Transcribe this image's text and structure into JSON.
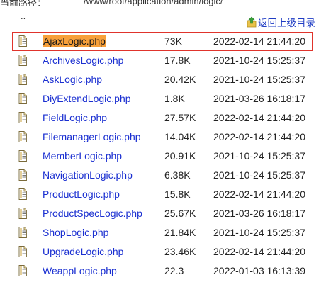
{
  "path_bar": {
    "label": "当前路径：",
    "value": "/www/root/application/admin/logic/"
  },
  "parent_link": "..",
  "back_link": {
    "label": "返回上级目录",
    "icon": "folder-up-icon"
  },
  "files": [
    {
      "name": "AjaxLogic.php",
      "size": "73K",
      "date": "2022-02-14 21:44:20",
      "highlighted": true
    },
    {
      "name": "ArchivesLogic.php",
      "size": "17.8K",
      "date": "2021-10-24 15:25:37"
    },
    {
      "name": "AskLogic.php",
      "size": "20.42K",
      "date": "2021-10-24 15:25:37"
    },
    {
      "name": "DiyExtendLogic.php",
      "size": "1.8K",
      "date": "2021-03-26 16:18:17"
    },
    {
      "name": "FieldLogic.php",
      "size": "27.57K",
      "date": "2022-02-14 21:44:20"
    },
    {
      "name": "FilemanagerLogic.php",
      "size": "14.04K",
      "date": "2022-02-14 21:44:20"
    },
    {
      "name": "MemberLogic.php",
      "size": "20.91K",
      "date": "2021-10-24 15:25:37"
    },
    {
      "name": "NavigationLogic.php",
      "size": "6.38K",
      "date": "2021-10-24 15:25:37"
    },
    {
      "name": "ProductLogic.php",
      "size": "15.8K",
      "date": "2022-02-14 21:44:20"
    },
    {
      "name": "ProductSpecLogic.php",
      "size": "25.67K",
      "date": "2021-03-26 16:18:17"
    },
    {
      "name": "ShopLogic.php",
      "size": "21.84K",
      "date": "2021-10-24 15:25:37"
    },
    {
      "name": "UpgradeLogic.php",
      "size": "23.46K",
      "date": "2022-02-14 21:44:20"
    },
    {
      "name": "WeappLogic.php",
      "size": "22.3",
      "date": "2022-01-03 16:13:39"
    }
  ],
  "colors": {
    "link": "#1a2fd1",
    "highlight_box": "#e0342c",
    "highlight_fill": "#f7a03a"
  }
}
